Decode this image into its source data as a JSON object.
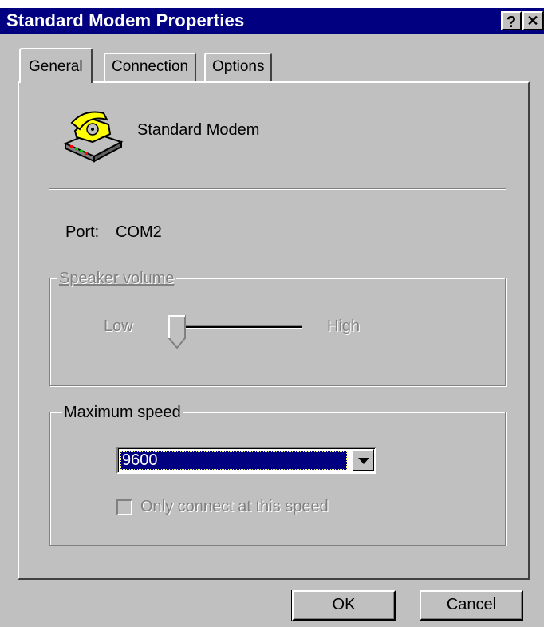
{
  "window": {
    "title": "Standard Modem Properties",
    "help_button": "?",
    "close_button": "✕",
    "top_fragment": "(          )"
  },
  "tabs": [
    {
      "label": "General",
      "active": true
    },
    {
      "label": "Connection",
      "active": false
    },
    {
      "label": "Options",
      "active": false
    }
  ],
  "general": {
    "modem_name": "Standard Modem",
    "port_label": "Port:",
    "port_value": "COM2",
    "speaker_volume": {
      "legend": "Speaker volume",
      "low_label": "Low",
      "high_label": "High",
      "level": 0,
      "enabled": false
    },
    "maximum_speed": {
      "legend": "Maximum speed",
      "selected": "9600",
      "only_connect_label": "Only connect at this speed",
      "only_connect_checked": false,
      "only_connect_enabled": false
    }
  },
  "buttons": {
    "ok": "OK",
    "cancel": "Cancel"
  },
  "colors": {
    "titlebar": "#000080",
    "face": "#c0c0c0",
    "selection": "#000080"
  },
  "icons": {
    "modem": "telephone-modem-icon",
    "dropdown": "chevron-down-icon"
  }
}
